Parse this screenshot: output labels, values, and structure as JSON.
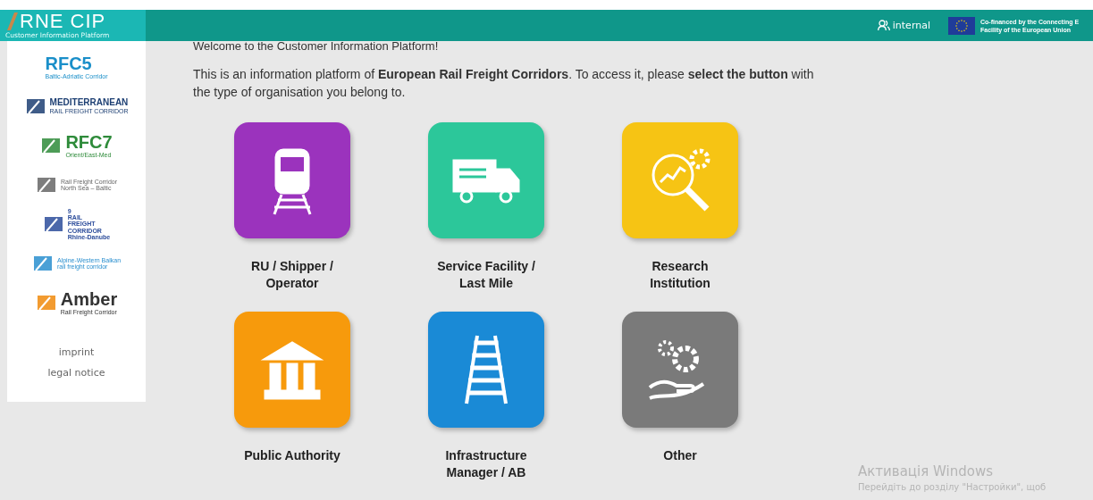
{
  "header": {
    "logo": {
      "title": "RNE CIP",
      "subtitle": "Customer Information Platform"
    },
    "user": "internal",
    "eu_notice": [
      "Co-financed by the Connecting E",
      "Facility of the European Union"
    ]
  },
  "sidebar": {
    "logos": [
      {
        "kind": "rfc5",
        "lines": [
          "RFC5",
          "Baltic-Adriatic Corridor"
        ]
      },
      {
        "kind": "med",
        "lines": [
          "MEDITERRANEAN",
          "RAIL FREIGHT CORRIDOR"
        ]
      },
      {
        "kind": "rfc7",
        "lines": [
          "RFC7",
          "Orient/East-Med"
        ]
      },
      {
        "kind": "nsb",
        "lines": [
          "Rail Freight Corridor",
          "North Sea – Baltic"
        ]
      },
      {
        "kind": "rd",
        "lines": [
          "9",
          "RAIL",
          "FREIGHT",
          "CORRIDOR",
          "Rhine-Danube"
        ]
      },
      {
        "kind": "awb",
        "lines": [
          "Alpine-Western Balkan",
          "rail freight corridor"
        ]
      },
      {
        "kind": "amber",
        "lines": [
          "Amber",
          "Rail Freight Corridor"
        ]
      }
    ],
    "links": [
      "imprint",
      "legal notice"
    ]
  },
  "main": {
    "welcome": "Welcome to the Customer Information Platform!",
    "intro": "This is an information platform of **European Rail Freight Corridors**. To access it, please **select the button** with the type of organisation you belong to.",
    "tiles": [
      {
        "kind": "train",
        "label": "RU / Shipper / Operator",
        "color": "#9b33bd"
      },
      {
        "kind": "truck",
        "label": "Service Facility / Last Mile",
        "color": "#2cc79a"
      },
      {
        "kind": "research",
        "label": "Research Institution",
        "color": "#f6c414"
      },
      {
        "kind": "building",
        "label": "Public Authority",
        "color": "#f79a0c"
      },
      {
        "kind": "tracks",
        "label": "Infrastructure Manager / AB",
        "color": "#1a8ad6"
      },
      {
        "kind": "gears",
        "label": "Other",
        "color": "#7a7a7a"
      }
    ]
  },
  "os_notice": {
    "title": "Активація Windows",
    "text": "Перейдіть до розділу \"Настройки\", щоб"
  }
}
